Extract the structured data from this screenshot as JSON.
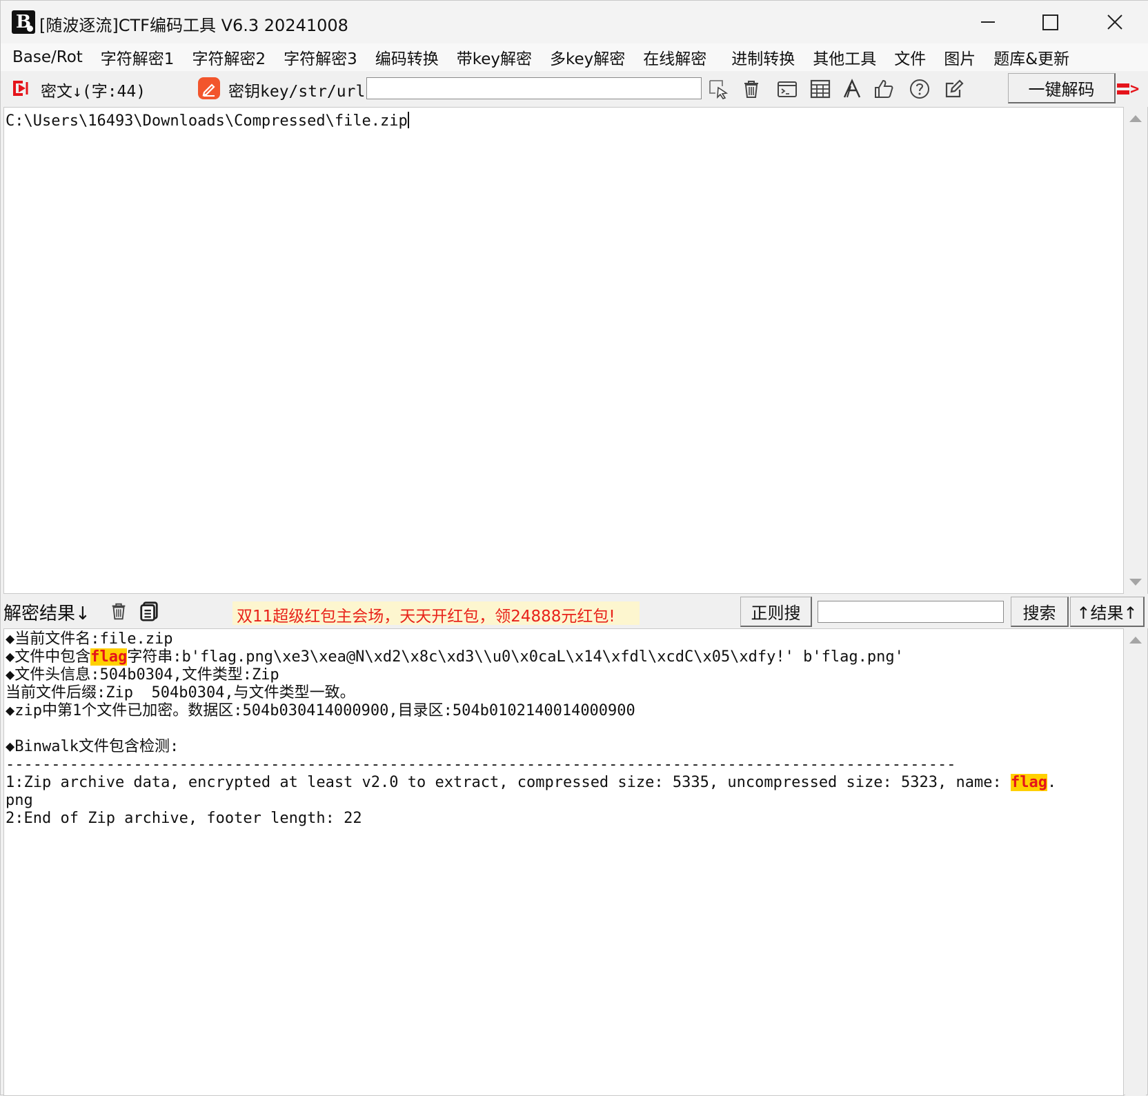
{
  "window": {
    "title": "[随波逐流]CTF编码工具 V6.3 20241008",
    "app_icon_text": "B"
  },
  "menu": [
    "Base/Rot",
    "字符解密1",
    "字符解密2",
    "字符解密3",
    "编码转换",
    "带key解密",
    "多key解密",
    "在线解密",
    "进制转换",
    "其他工具",
    "文件",
    "图片",
    "题库&更新"
  ],
  "toolbar": {
    "ciphertext_label": "密文↓(字:44)",
    "key_label": "密钥key/str/url:",
    "key_value": "",
    "decode_all_label": "一键解码",
    "arrow_text": ">"
  },
  "input": {
    "text": "C:\\Users\\16493\\Downloads\\Compressed\\file.zip"
  },
  "result_bar": {
    "label": "解密结果↓",
    "ad_text": "双11超级红包主会场，天天开红包，领24888元红包!",
    "regex_label": "正则搜",
    "search_value": "",
    "search_label": "搜索",
    "result_up_label": "↑结果↑"
  },
  "output": {
    "line1": "◆当前文件名:file.zip",
    "line2_pre": "◆文件中包含",
    "line2_hl": "flag",
    "line2_post": "字符串:b'flag.png\\xe3\\xea@N\\xd2\\x8c\\xd3\\\\u0\\x0caL\\x14\\xfdl\\xcdC\\x05\\xdfy!' b'flag.png'",
    "line3": "◆文件头信息:504b0304,文件类型:Zip",
    "line4": "当前文件后缀:Zip  504b0304,与文件类型一致。",
    "line5": "◆zip中第1个文件已加密。数据区:504b030414000900,目录区:504b0102140014000900",
    "line6": "",
    "line7": "◆Binwalk文件包含检测:",
    "line8": "--------------------------------------------------------------------------------------------------------",
    "line9_pre": "1:Zip archive data, encrypted at least v2.0 to extract, compressed size: 5335, uncompressed size: 5323, name: ",
    "line9_hl": "flag",
    "line9_post": ".",
    "line10": "png",
    "line11": "2:End of Zip archive, footer length: 22"
  },
  "colors": {
    "accent_red": "#e5141b",
    "highlight_bg": "#ffd000",
    "ad_bg": "#fdf6cf",
    "key_icon": "#f2552c"
  }
}
